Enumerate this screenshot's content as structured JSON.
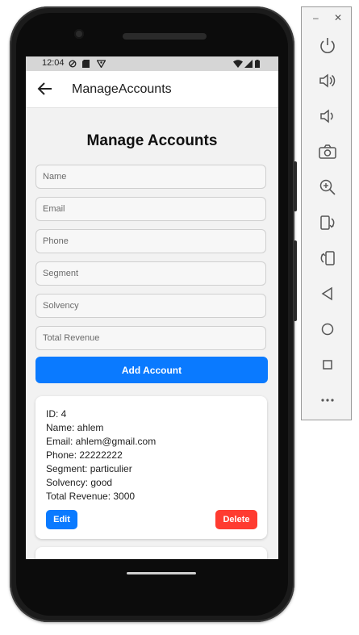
{
  "status_bar": {
    "time": "12:04"
  },
  "app_bar": {
    "title": "ManageAccounts"
  },
  "page": {
    "heading": "Manage Accounts"
  },
  "form": {
    "name_placeholder": "Name",
    "email_placeholder": "Email",
    "phone_placeholder": "Phone",
    "segment_placeholder": "Segment",
    "solvency_placeholder": "Solvency",
    "total_revenue_placeholder": "Total Revenue",
    "add_label": "Add Account"
  },
  "accounts": [
    {
      "id_line": "ID: 4",
      "name_line": "Name: ahlem",
      "email_line": "Email: ahlem@gmail.com",
      "phone_line": "Phone: 22222222",
      "segment_line": "Segment: particulier",
      "solvency_line": "Solvency: good",
      "revenue_line": "Total Revenue: 3000",
      "edit_label": "Edit",
      "delete_label": "Delete"
    }
  ],
  "colors": {
    "primary": "#0a7aff",
    "danger": "#ff3b30",
    "background": "#f2f2f2"
  },
  "emulator_toolbar": {
    "window_controls": [
      "minimize-icon",
      "close-icon"
    ],
    "buttons": [
      "power-icon",
      "volume-up-icon",
      "volume-down-icon",
      "camera-icon",
      "zoom-icon",
      "rotate-left-icon",
      "rotate-right-icon",
      "back-icon",
      "home-icon",
      "overview-icon",
      "more-icon"
    ],
    "minimize_glyph": "–",
    "close_glyph": "✕"
  }
}
